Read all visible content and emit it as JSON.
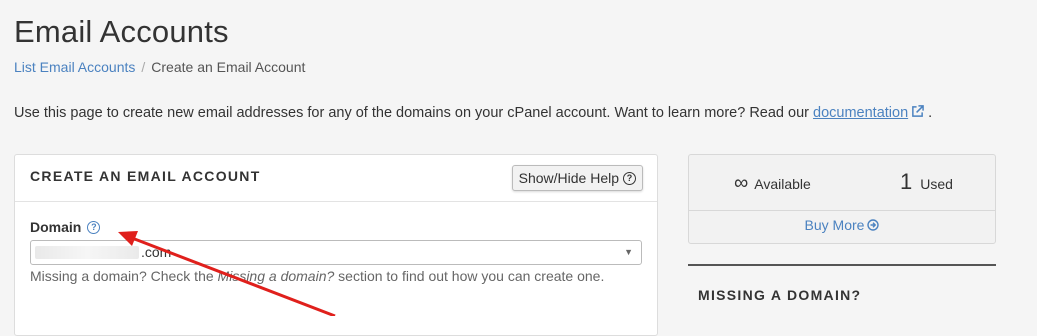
{
  "page": {
    "title": "Email Accounts",
    "breadcrumb": {
      "link": "List Email Accounts",
      "separator": "/",
      "current": "Create an Email Account"
    },
    "intro_text": "Use this page to create new email addresses for any of the domains on your cPanel account. Want to learn more? Read our ",
    "intro_link": "documentation",
    "intro_end": " ."
  },
  "create_panel": {
    "title": "CREATE AN EMAIL ACCOUNT",
    "help_button": "Show/Hide Help",
    "domain_label": "Domain",
    "domain_value": ".com",
    "domain_hint_pre": "Missing a domain? Check the ",
    "domain_hint_em": "Missing a domain?",
    "domain_hint_post": " section to find out how you can create one."
  },
  "side": {
    "available_value": "∞",
    "available_label": "Available",
    "used_value": "1",
    "used_label": "Used",
    "buy_more": "Buy More",
    "missing_heading": "MISSING A DOMAIN?"
  },
  "colors": {
    "link": "#4b82c0",
    "annotation_arrow": "#e0201c"
  }
}
